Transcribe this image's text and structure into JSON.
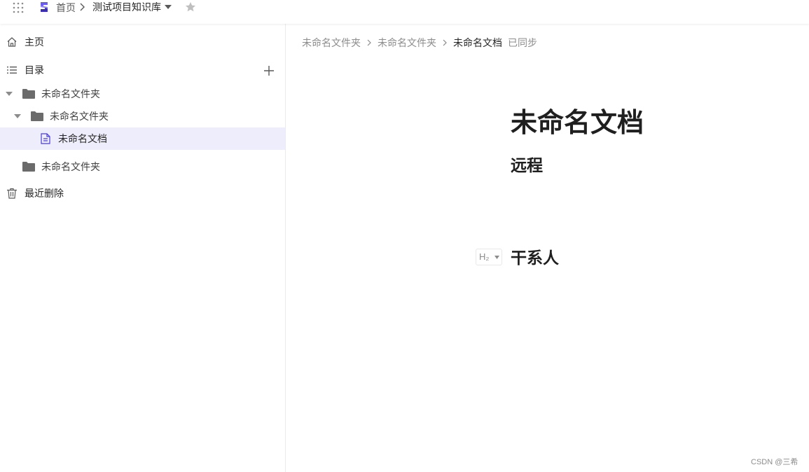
{
  "topbar": {
    "home_label": "首页",
    "knowledge_base_title": "测试项目知识库",
    "brand_color": "#4b3fd1"
  },
  "sidebar": {
    "home_label": "主页",
    "catalog_label": "目录",
    "tree": [
      {
        "label": "未命名文件夹",
        "type": "folder",
        "expanded": true
      },
      {
        "label": "未命名文件夹",
        "type": "folder",
        "expanded": true
      },
      {
        "label": "未命名文档",
        "type": "document",
        "selected": true
      },
      {
        "label": "未命名文件夹",
        "type": "folder",
        "expanded": false
      }
    ],
    "trash_label": "最近删除",
    "active_bg": "#eeedfb"
  },
  "main": {
    "breadcrumb": [
      "未命名文件夹",
      "未命名文件夹",
      "未命名文档"
    ],
    "sync_status": "已同步",
    "doc_title": "未命名文档",
    "heading_1": "远程",
    "heading_2": "干系人",
    "heading_badge": "H₂"
  },
  "watermark": "CSDN @三希"
}
